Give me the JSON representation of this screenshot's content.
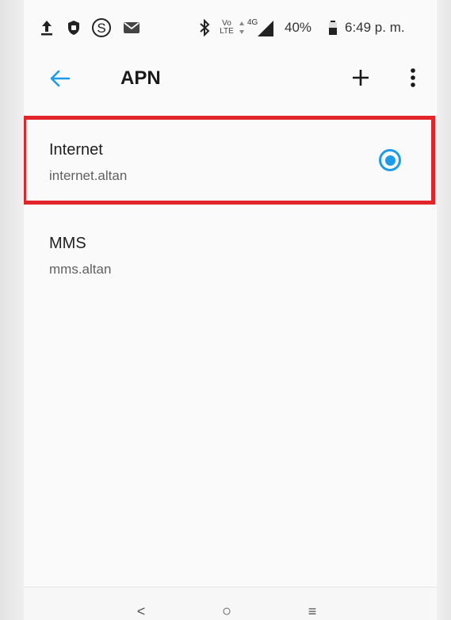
{
  "status_bar": {
    "icons": [
      "upload-icon",
      "shield-icon",
      "s-circle-icon",
      "mail-icon",
      "bluetooth-icon",
      "volte-icon",
      "data-arrows-icon",
      "signal-4g-icon",
      "battery-icon"
    ],
    "volte_top": "Vo",
    "volte_bottom": "LTE",
    "network": "4G",
    "battery": "40%",
    "time": "6:49 p. m."
  },
  "app_bar": {
    "title": "APN"
  },
  "apn_list": [
    {
      "name": "Internet",
      "apn": "internet.altan",
      "selected": true
    },
    {
      "name": "MMS",
      "apn": "mms.altan",
      "selected": false
    }
  ],
  "colors": {
    "accent": "#1e9be9",
    "highlight": "#e2252b",
    "background": "#fafafa"
  },
  "nav_bar": {
    "back": "<",
    "home": "○",
    "recents": "≡"
  }
}
